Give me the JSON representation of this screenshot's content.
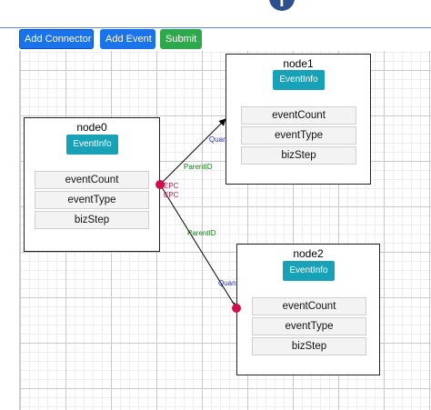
{
  "header": {
    "social_icon": "facebook-icon",
    "social_glyph": "f"
  },
  "toolbar": {
    "add_connector_label": "Add Connector",
    "add_event_label": "Add Event",
    "submit_label": "Submit"
  },
  "nodes": {
    "node0": {
      "title": "node0",
      "event_button": "EventInfo",
      "fields": [
        "eventCount",
        "eventType",
        "bizStep"
      ]
    },
    "node1": {
      "title": "node1",
      "event_button": "EventInfo",
      "fields": [
        "eventCount",
        "eventType",
        "bizStep"
      ]
    },
    "node2": {
      "title": "node2",
      "event_button": "EventInfo",
      "fields": [
        "eventCount",
        "eventType",
        "bizStep"
      ]
    }
  },
  "edges": {
    "edge1": {
      "source_label": "EPC",
      "middle_label": "ParentID",
      "target_label": "Quan"
    },
    "edge2": {
      "source_label": "EPC",
      "middle_label": "ParentID",
      "target_label": "Quan"
    }
  },
  "colors": {
    "accent_blue": "#1a73e8",
    "submit_green": "#2ea84a",
    "event_teal": "#17a2b8",
    "port_red": "#d0104a",
    "label_green": "#1b7a1b",
    "label_blue": "#1f2fc0"
  }
}
